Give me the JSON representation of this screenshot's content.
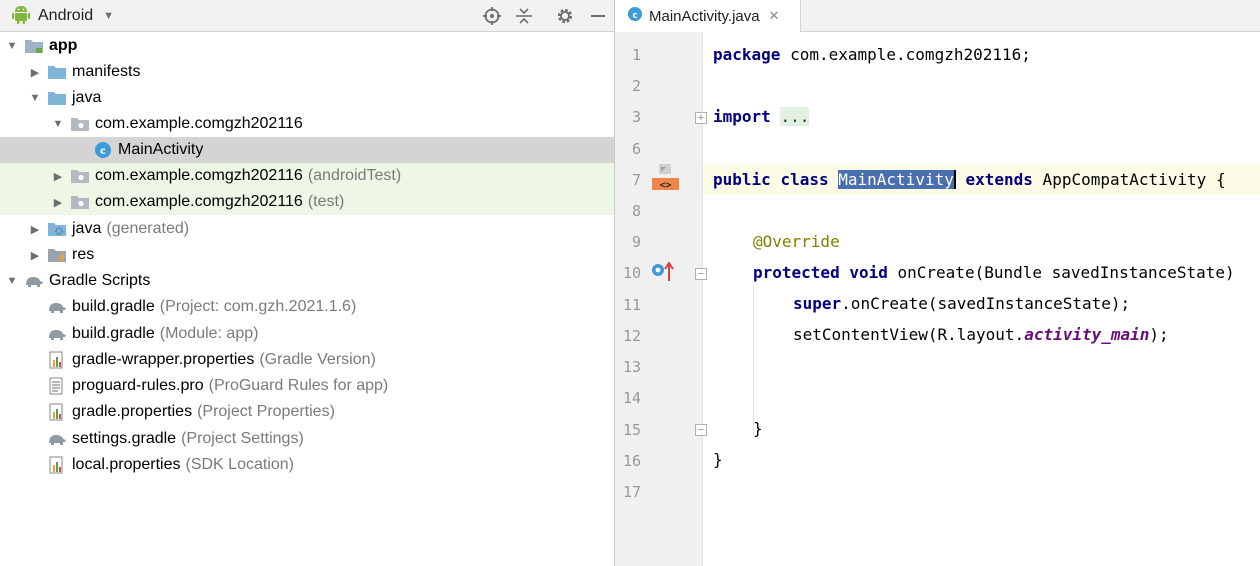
{
  "project_panel": {
    "view_label": "Android",
    "tree": [
      {
        "label": "app",
        "hint": ""
      },
      {
        "label": "manifests",
        "hint": ""
      },
      {
        "label": "java",
        "hint": ""
      },
      {
        "label": "com.example.comgzh202116",
        "hint": ""
      },
      {
        "label": "MainActivity",
        "hint": ""
      },
      {
        "label": "com.example.comgzh202116",
        "hint": "(androidTest)"
      },
      {
        "label": "com.example.comgzh202116",
        "hint": "(test)"
      },
      {
        "label": "java",
        "hint": "(generated)"
      },
      {
        "label": "res",
        "hint": ""
      },
      {
        "label": "Gradle Scripts",
        "hint": ""
      },
      {
        "label": "build.gradle",
        "hint": "(Project: com.gzh.2021.1.6)"
      },
      {
        "label": "build.gradle",
        "hint": "(Module: app)"
      },
      {
        "label": "gradle-wrapper.properties",
        "hint": "(Gradle Version)"
      },
      {
        "label": "proguard-rules.pro",
        "hint": "(ProGuard Rules for app)"
      },
      {
        "label": "gradle.properties",
        "hint": "(Project Properties)"
      },
      {
        "label": "settings.gradle",
        "hint": "(Project Settings)"
      },
      {
        "label": "local.properties",
        "hint": "(SDK Location)"
      }
    ]
  },
  "editor": {
    "tab_label": "MainActivity.java",
    "line_numbers": [
      "1",
      "2",
      "3",
      "6",
      "7",
      "8",
      "9",
      "10",
      "11",
      "12",
      "13",
      "14",
      "15",
      "16",
      "17"
    ],
    "code": {
      "l1_kw": "package",
      "l1_rest": " com.example.comgzh202116;",
      "l3_kw": "import",
      "l3_dots": "...",
      "l7_kw1": "public",
      "l7_kw2": "class",
      "l7_sel": "MainActivity",
      "l7_kw3": "extends",
      "l7_rest": " AppCompatActivity {",
      "l9_ann": "@Override",
      "l10_kw1": "protected",
      "l10_kw2": "void",
      "l10_rest": " onCreate(Bundle savedInstanceState)",
      "l11_kw": "super",
      "l11_rest": ".onCreate(savedInstanceState);",
      "l12_pre": "setContentView(R.layout.",
      "l12_field": "activity_main",
      "l12_post": ");",
      "l15_brace": "}",
      "l16_brace": "}"
    }
  },
  "colors": {
    "selection_row": "#d4d4d4",
    "test_row": "#eef7e6",
    "keyword": "#000080",
    "annotation": "#808000",
    "field": "#660e7a",
    "selection_highlight": "#4a6fb0"
  }
}
